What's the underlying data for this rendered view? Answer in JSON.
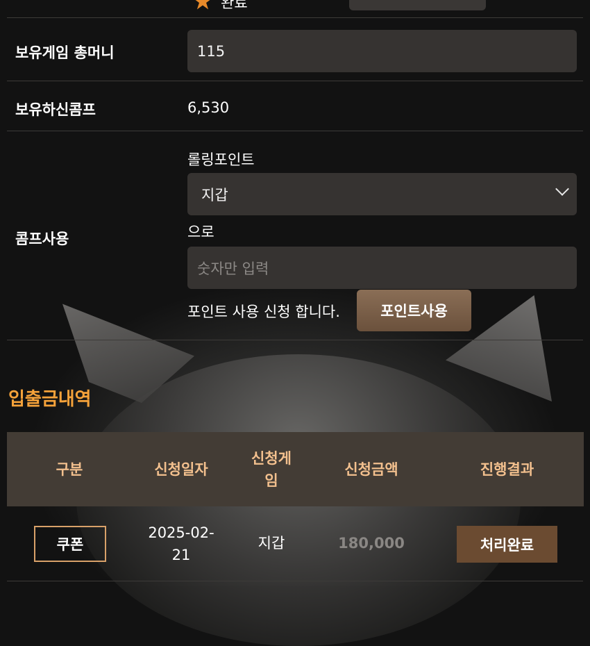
{
  "top": {
    "fragment_text": "완료"
  },
  "game_money": {
    "label": "보유게임 총머니",
    "value": "115"
  },
  "comp": {
    "label": "보유하신콤프",
    "value": "6,530"
  },
  "comp_use": {
    "label": "콤프사용",
    "rolling_label": "롤링포인트",
    "select_value": "지갑",
    "to_label": "으로",
    "amount_placeholder": "숫자만 입력",
    "apply_text": "포인트 사용 신청 합니다.",
    "button_label": "포인트사용"
  },
  "history": {
    "title": "입출금내역",
    "columns": [
      "구분",
      "신청일자",
      "신청게\n임",
      "신청금액",
      "진행결과"
    ],
    "rows": [
      {
        "type": "쿠폰",
        "date": "2025-02-\n21",
        "game": "지갑",
        "amount": "180,000",
        "status": "처리완료"
      }
    ]
  },
  "colors": {
    "accent": "#f5a23a",
    "header_bg": "#433c35",
    "field_bg": "#363331",
    "button_brown": "#6b4b31"
  }
}
